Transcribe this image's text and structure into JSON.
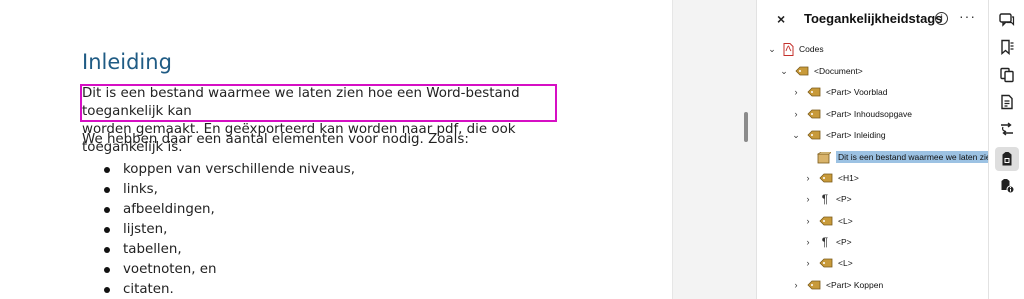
{
  "document": {
    "heading": "Inleiding",
    "paragraph1_line1": "Dit is een bestand waarmee we laten zien hoe een Word-bestand toegankelijk kan",
    "paragraph1_line2": "worden gemaakt. En geëxporteerd kan worden naar pdf, die ook toegankelijk is.",
    "paragraph2": "We hebben daar een aantal elementen voor nodig. Zoals:",
    "list": [
      "koppen van verschillende niveaus,",
      "links,",
      "afbeeldingen,",
      "lijsten,",
      "tabellen,",
      "voetnoten, en",
      "citaten."
    ]
  },
  "panel": {
    "close_symbol": "×",
    "title": "Toegankelijkheidstags",
    "info_symbol": "i",
    "more_symbol": "···"
  },
  "tree": [
    {
      "label": "Codes",
      "chevron": "⌄",
      "icon": "pdf-icon"
    },
    {
      "label": "<Document>",
      "chevron": "⌄",
      "icon": "tag-icon"
    },
    {
      "label": "<Part> Voorblad",
      "chevron": "›",
      "icon": "tag-icon"
    },
    {
      "label": "<Part> Inhoudsopgave",
      "chevron": "›",
      "icon": "tag-icon"
    },
    {
      "label": "<Part> Inleiding",
      "chevron": "⌄",
      "icon": "tag-icon"
    },
    {
      "label": "Dit is een bestand waarmee we laten zie",
      "chevron": "",
      "icon": "content-box-icon",
      "selected": true
    },
    {
      "label": "<H1>",
      "chevron": "›",
      "icon": "tag-icon"
    },
    {
      "label": "<P>",
      "chevron": "›",
      "icon": "paragraph-icon"
    },
    {
      "label": "<L>",
      "chevron": "›",
      "icon": "tag-icon"
    },
    {
      "label": "<P>",
      "chevron": "›",
      "icon": "paragraph-icon"
    },
    {
      "label": "<L>",
      "chevron": "›",
      "icon": "tag-icon"
    },
    {
      "label": "<Part> Koppen",
      "chevron": "›",
      "icon": "tag-icon"
    }
  ],
  "toolbar_icons": [
    "comment-icon",
    "bookmark-icon",
    "pages-icon",
    "document-icon",
    "share-arrows-icon",
    "accessibility-tags-icon",
    "accessibility-settings-icon"
  ],
  "colors": {
    "heading": "#1f5b84",
    "highlight_border": "#d60fc4",
    "selection": "#9cc2e3",
    "tag": "#c89a3a"
  }
}
